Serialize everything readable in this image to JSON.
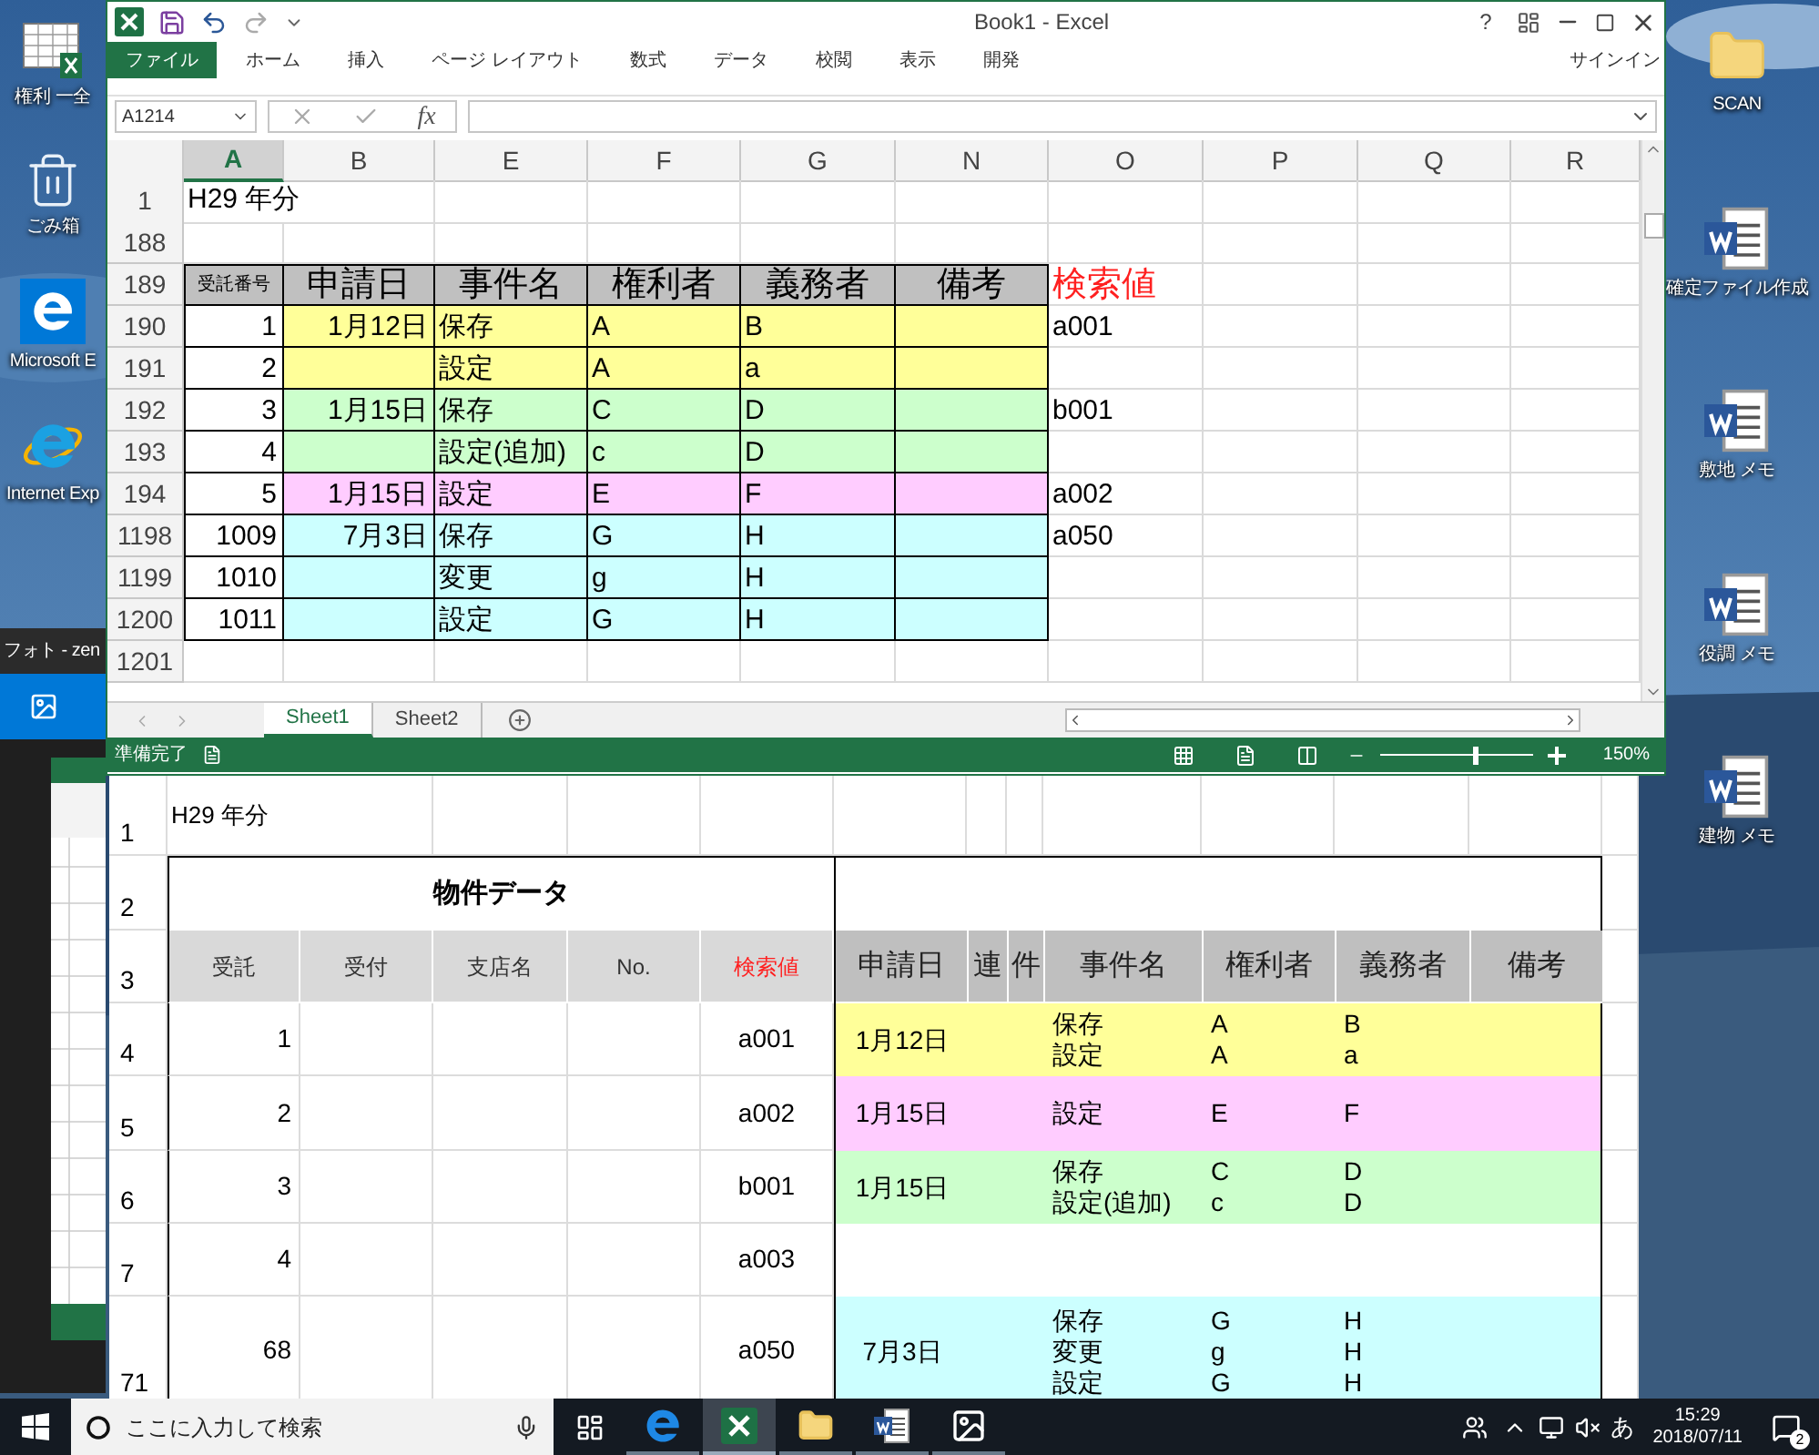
{
  "desktop": {
    "icons_left": [
      {
        "kind": "sheet",
        "label": "権利 一全"
      },
      {
        "kind": "bin",
        "label": "ごみ箱"
      },
      {
        "kind": "edge",
        "label": "Microsoft E"
      },
      {
        "kind": "ie",
        "label": "Internet Exp"
      }
    ],
    "icons_right": [
      {
        "kind": "folder",
        "label": "SCAN"
      },
      {
        "kind": "doc",
        "label": "確定ファイル作成"
      },
      {
        "kind": "doc",
        "label": "敷地 メモ"
      },
      {
        "kind": "doc",
        "label": "役調 メモ"
      },
      {
        "kind": "doc",
        "label": "建物 メモ"
      }
    ]
  },
  "photos_window": {
    "title": "フォト - zen"
  },
  "excel": {
    "title": "Book1 - Excel",
    "help": "?",
    "ribbon_tabs": [
      {
        "label": "ファイル",
        "selected": true
      },
      {
        "label": "ホーム",
        "selected": false
      },
      {
        "label": "挿入",
        "selected": false
      },
      {
        "label": "ページ レイアウト",
        "selected": false
      },
      {
        "label": "数式",
        "selected": false
      },
      {
        "label": "データ",
        "selected": false
      },
      {
        "label": "校閲",
        "selected": false
      },
      {
        "label": "表示",
        "selected": false
      },
      {
        "label": "開発",
        "selected": false
      }
    ],
    "sign_in": "サインイン",
    "name_box": "A1214",
    "fx": "fx",
    "columns": [
      {
        "label": "A",
        "selected": true
      },
      {
        "label": "B",
        "selected": false
      },
      {
        "label": "E",
        "selected": false
      },
      {
        "label": "F",
        "selected": false
      },
      {
        "label": "G",
        "selected": false
      },
      {
        "label": "N",
        "selected": false
      },
      {
        "label": "O",
        "selected": false
      },
      {
        "label": "P",
        "selected": false
      },
      {
        "label": "Q",
        "selected": false
      },
      {
        "label": "R",
        "selected": false
      }
    ],
    "rows": [
      {
        "header": "1",
        "kind": "plain",
        "cells": [
          "H29 年分"
        ]
      },
      {
        "header": "188",
        "kind": "plain"
      },
      {
        "header": "189",
        "kind": "header",
        "cells": [
          "受託番号",
          "申請日",
          "事件名",
          "権利者",
          "義務者",
          "備考",
          "検索値"
        ]
      },
      {
        "header": "190",
        "kind": "data",
        "color": "#ffff99",
        "cells": [
          "1",
          "1月12日",
          "保存",
          "A",
          "B",
          null,
          "a001"
        ]
      },
      {
        "header": "191",
        "kind": "data",
        "color": "#ffff99",
        "cells": [
          "2",
          null,
          "設定",
          "A",
          "a"
        ]
      },
      {
        "header": "192",
        "kind": "data",
        "color": "#ccffcc",
        "cells": [
          "3",
          "1月15日",
          "保存",
          "C",
          "D",
          null,
          "b001"
        ]
      },
      {
        "header": "193",
        "kind": "data",
        "color": "#ccffcc",
        "cells": [
          "4",
          null,
          "設定(追加)",
          "c",
          "D"
        ]
      },
      {
        "header": "194",
        "kind": "data",
        "color": "#ffccff",
        "cells": [
          "5",
          "1月15日",
          "設定",
          "E",
          "F",
          null,
          "a002"
        ]
      },
      {
        "header": "1198",
        "kind": "data",
        "color": "#ccffff",
        "cells": [
          "1009",
          "7月3日",
          "保存",
          "G",
          "H",
          null,
          "a050"
        ]
      },
      {
        "header": "1199",
        "kind": "data",
        "color": "#ccffff",
        "cells": [
          "1010",
          null,
          "変更",
          "g",
          "H"
        ]
      },
      {
        "header": "1200",
        "kind": "data",
        "color": "#ccffff",
        "cells": [
          "1011",
          null,
          "設定",
          "G",
          "H"
        ]
      },
      {
        "header": "1201",
        "kind": "plain"
      }
    ],
    "sheets": [
      {
        "label": "Sheet1",
        "selected": true
      },
      {
        "label": "Sheet2",
        "selected": false
      }
    ],
    "status": "準備完了",
    "zoom": {
      "level": 0.6,
      "reading": "150%"
    }
  },
  "printout": {
    "title_row": {
      "header": "1",
      "text": "H29 年分"
    },
    "caption_row": {
      "header": "2",
      "text": "物件データ"
    },
    "columns_row": {
      "header": "3",
      "left": [
        "受託",
        "受付",
        "支店名",
        "No.",
        "検索値"
      ],
      "right": [
        "申請日",
        "連",
        "件",
        "事件名",
        "権利者",
        "義務者",
        "備考"
      ]
    },
    "rows": [
      {
        "header": "4",
        "no": "1",
        "key": "a001",
        "date": "1月12日",
        "color": "#ffff99",
        "entries": [
          [
            "保存",
            "A",
            "B"
          ],
          [
            "設定",
            "A",
            "a"
          ]
        ]
      },
      {
        "header": "5",
        "no": "2",
        "key": "a002",
        "date": "1月15日",
        "color": "#ffccff",
        "entries": [
          [
            "設定",
            "E",
            "F"
          ]
        ]
      },
      {
        "header": "6",
        "no": "3",
        "key": "b001",
        "date": "1月15日",
        "color": "#ccffcc",
        "entries": [
          [
            "保存",
            "C",
            "D"
          ],
          [
            "設定(追加)",
            "c",
            "D"
          ]
        ]
      },
      {
        "header": "7",
        "no": "4",
        "key": "a003"
      },
      {
        "header": "71",
        "no": "68",
        "key": "a050",
        "date": "7月3日",
        "color": "#ccffff",
        "entries": [
          [
            "保存",
            "G",
            "H"
          ],
          [
            "変更",
            "g",
            "H"
          ],
          [
            "設定",
            "G",
            "H"
          ]
        ]
      }
    ]
  },
  "taskbar": {
    "search_placeholder": "ここに入力して検索",
    "apps": [
      {
        "kind": "edge",
        "selected": false
      },
      {
        "kind": "excel",
        "selected": true
      },
      {
        "kind": "folder",
        "selected": false
      },
      {
        "kind": "word",
        "selected": false
      },
      {
        "kind": "photos",
        "selected": false
      }
    ],
    "ime": "あ",
    "time": "15:29",
    "date": "2018/07/11",
    "notifications": "2"
  }
}
